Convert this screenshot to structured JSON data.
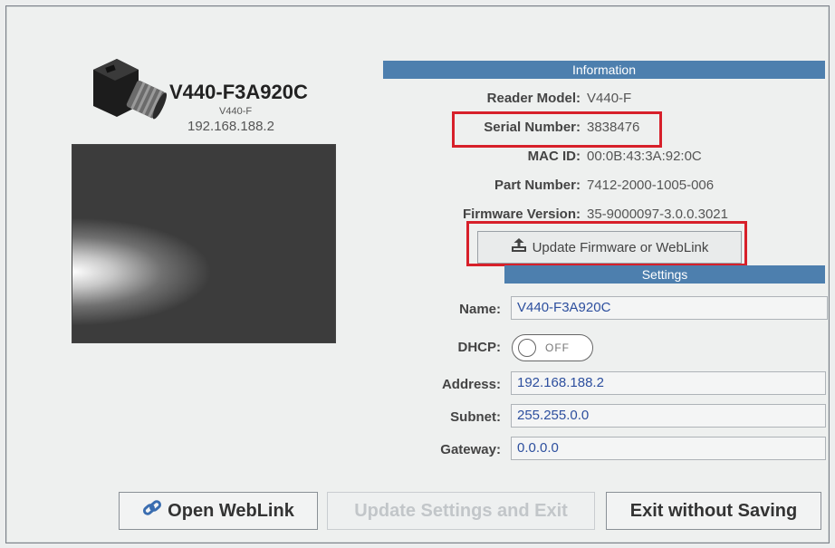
{
  "device": {
    "title": "V440-F3A920C",
    "model_short": "V440-F",
    "ip": "192.168.188.2"
  },
  "information": {
    "header": "Information",
    "rows": [
      {
        "label": "Reader Model:",
        "value": "V440-F"
      },
      {
        "label": "Serial Number:",
        "value": "3838476"
      },
      {
        "label": "MAC ID:",
        "value": "00:0B:43:3A:92:0C"
      },
      {
        "label": "Part Number:",
        "value": "7412-2000-1005-006"
      },
      {
        "label": "Firmware Version:",
        "value": "35-9000097-3.0.0.3021"
      }
    ],
    "update_button_label": "Update Firmware or WebLink"
  },
  "settings": {
    "header": "Settings",
    "name_label": "Name:",
    "name_value": "V440-F3A920C",
    "dhcp_label": "DHCP:",
    "dhcp_state": "OFF",
    "address_label": "Address:",
    "address_value": "192.168.188.2",
    "subnet_label": "Subnet:",
    "subnet_value": "255.255.0.0",
    "gateway_label": "Gateway:",
    "gateway_value": "0.0.0.0"
  },
  "buttons": {
    "open_weblink": "Open WebLink",
    "update_settings_exit": "Update Settings and Exit",
    "exit_without_saving": "Exit without Saving"
  },
  "colors": {
    "section_bar": "#4d7fae",
    "highlight": "#d7202a",
    "input_text": "#2d4f9e"
  }
}
